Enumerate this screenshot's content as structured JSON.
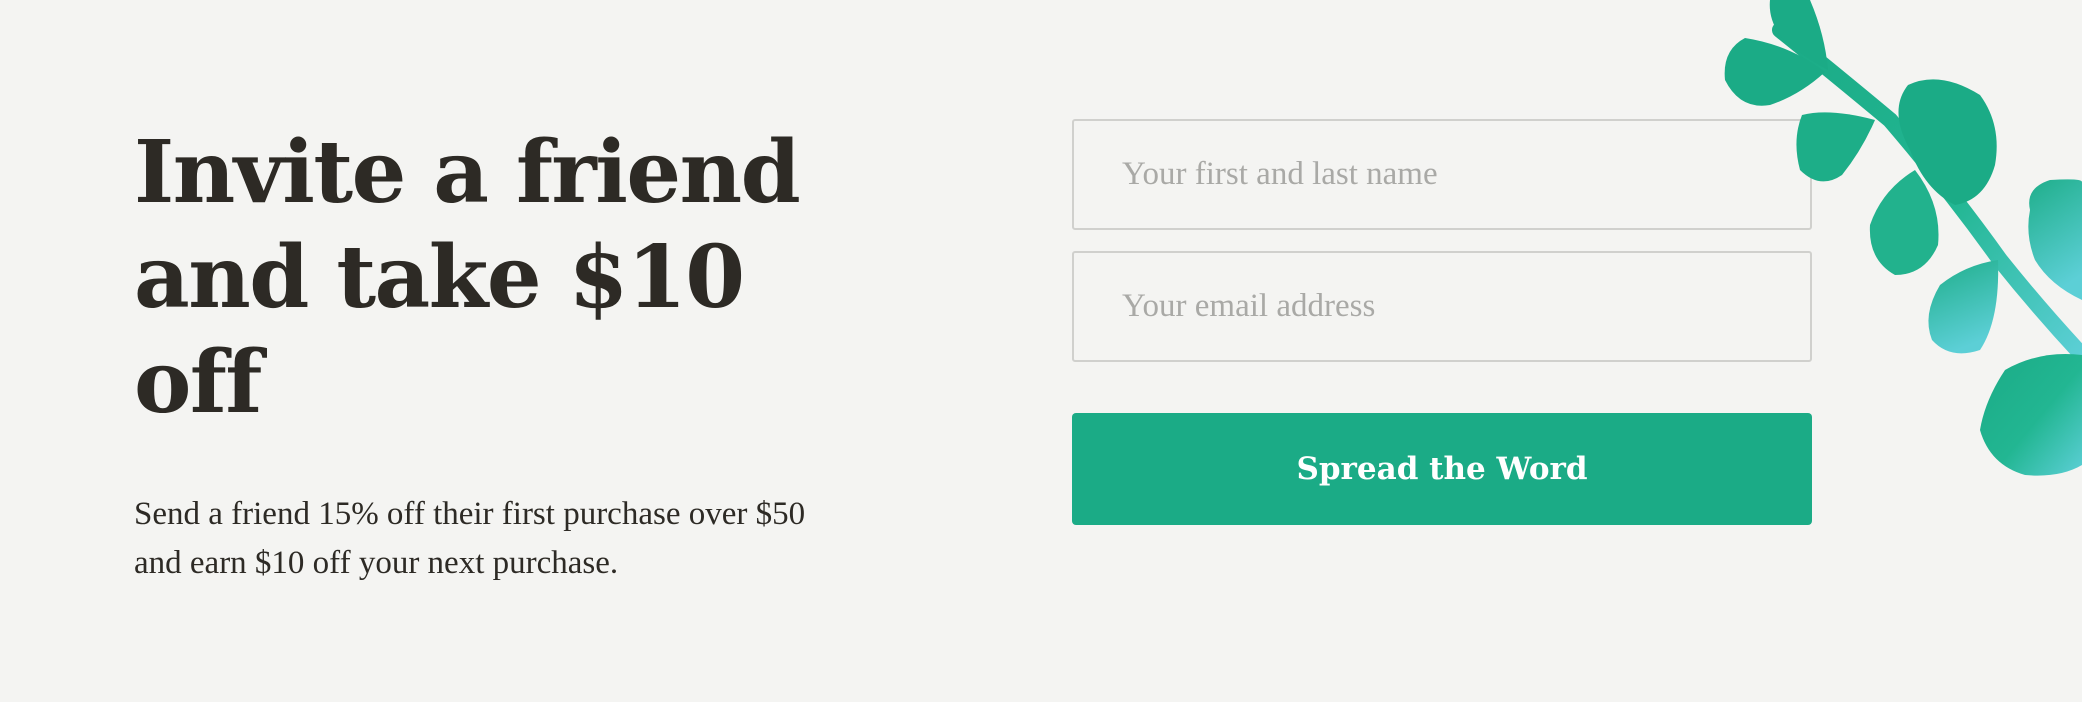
{
  "promo": {
    "headline": "Invite a friend and take $10 off",
    "description": "Send a friend 15% off their first purchase over $50 and earn $10 off your next purchase."
  },
  "form": {
    "name_placeholder": "Your first and last name",
    "email_placeholder": "Your email address",
    "submit_label": "Spread the Word"
  },
  "colors": {
    "background": "#f4f4f2",
    "text": "#2d2a25",
    "accent": "#1bab86",
    "leaf_teal": "#5ccfd6"
  },
  "decoration": {
    "icon": "eucalyptus-branch-icon"
  }
}
